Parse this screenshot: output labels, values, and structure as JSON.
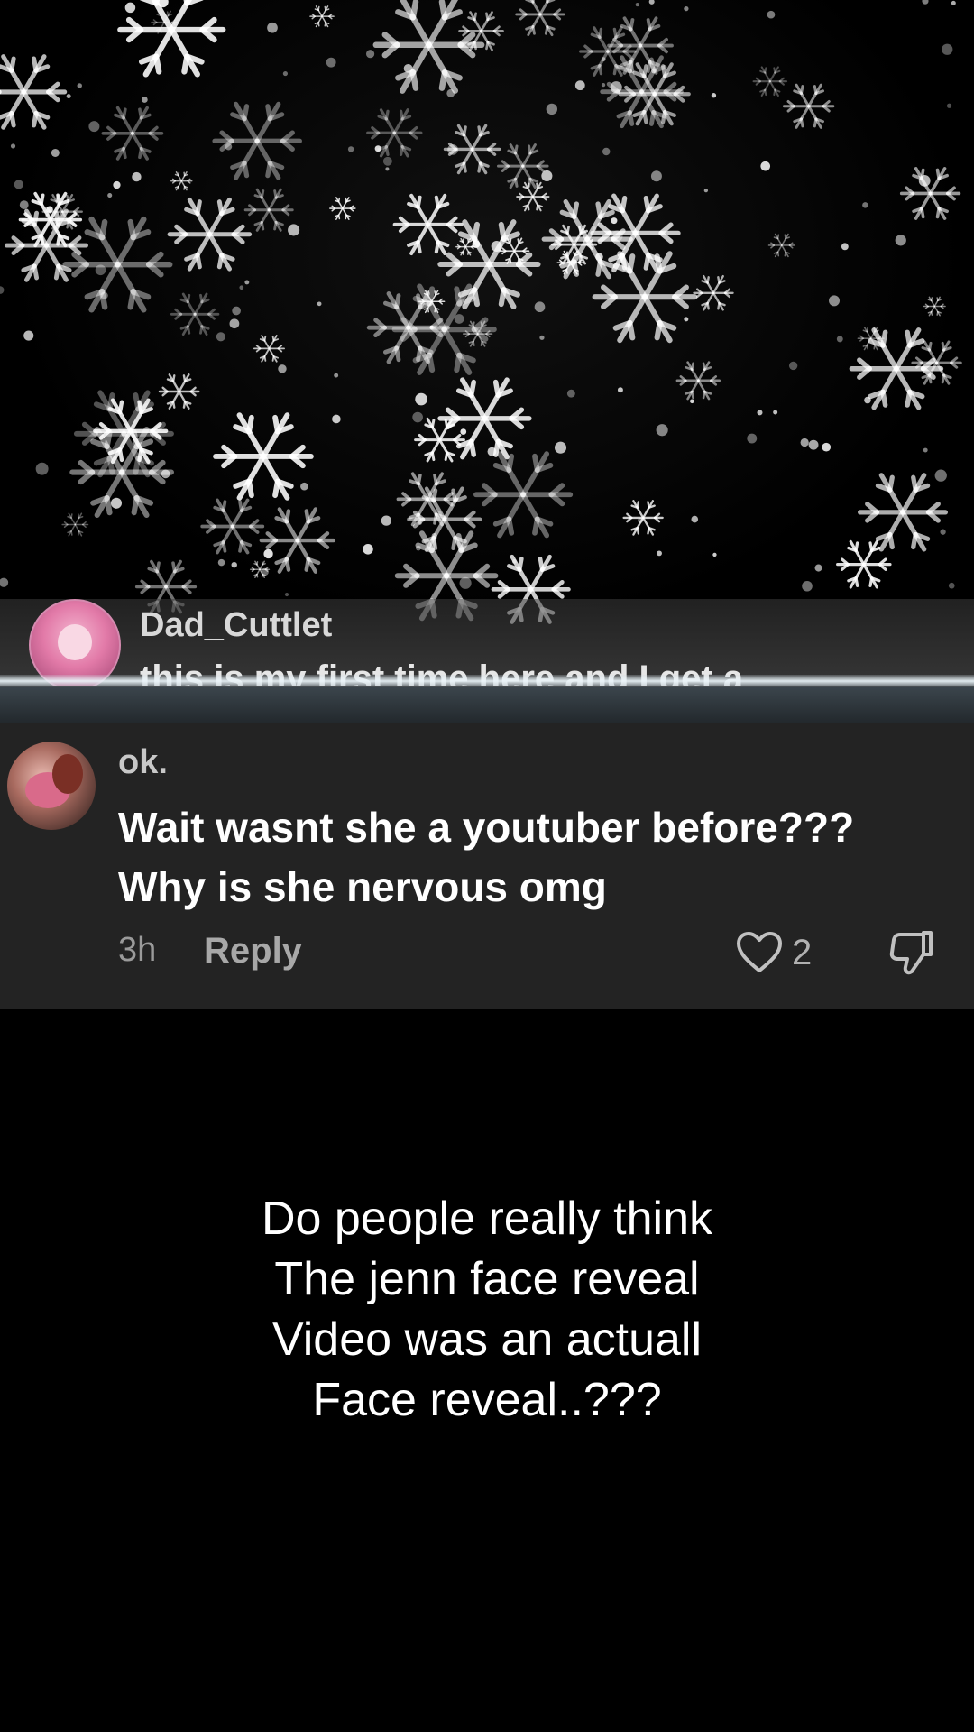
{
  "previous_comment": {
    "username": "Dad_Cuttlet",
    "text": "this is my first time here and I get a"
  },
  "comment": {
    "username": "ok.",
    "text_lines": [
      "Wait wasnt she a youtuber before???",
      "Why is she nervous omg"
    ],
    "time": "3h",
    "reply_label": "Reply",
    "like_count": "2",
    "icons": {
      "like": "heart-icon",
      "dislike": "thumbs-down-icon"
    }
  },
  "caption": {
    "lines": [
      "Do people really think",
      "The jenn face reveal",
      "Video was an actuall",
      "Face reveal..???"
    ]
  },
  "colors": {
    "background": "#000000",
    "card": "#232323",
    "username": "#c8c8c8",
    "text": "#ffffff",
    "meta": "#9a9a9a"
  }
}
